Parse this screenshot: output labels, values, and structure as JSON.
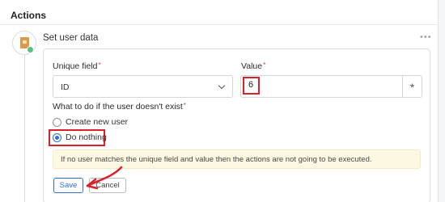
{
  "section": {
    "title": "Actions"
  },
  "action": {
    "title": "Set user data",
    "icon": "user-data-icon",
    "more_icon": "more-dots-icon"
  },
  "form": {
    "unique_field": {
      "label": "Unique field",
      "required": "*",
      "value": "ID"
    },
    "value_field": {
      "label": "Value",
      "required": "*",
      "value": "6",
      "side_button": "*"
    },
    "missing_user": {
      "label": "What to do if the user doesn't exist",
      "required": "*",
      "options": [
        {
          "label": "Create new user",
          "checked": false
        },
        {
          "label": "Do nothing",
          "checked": true
        }
      ]
    },
    "notice": "If no user matches the unique field and value then the actions are not going to be executed.",
    "save_label": "Save",
    "cancel_label": "Cancel"
  },
  "colors": {
    "highlight": "#d9202b",
    "accent": "#2f6fd6",
    "notice_bg": "#fcf8e2"
  }
}
